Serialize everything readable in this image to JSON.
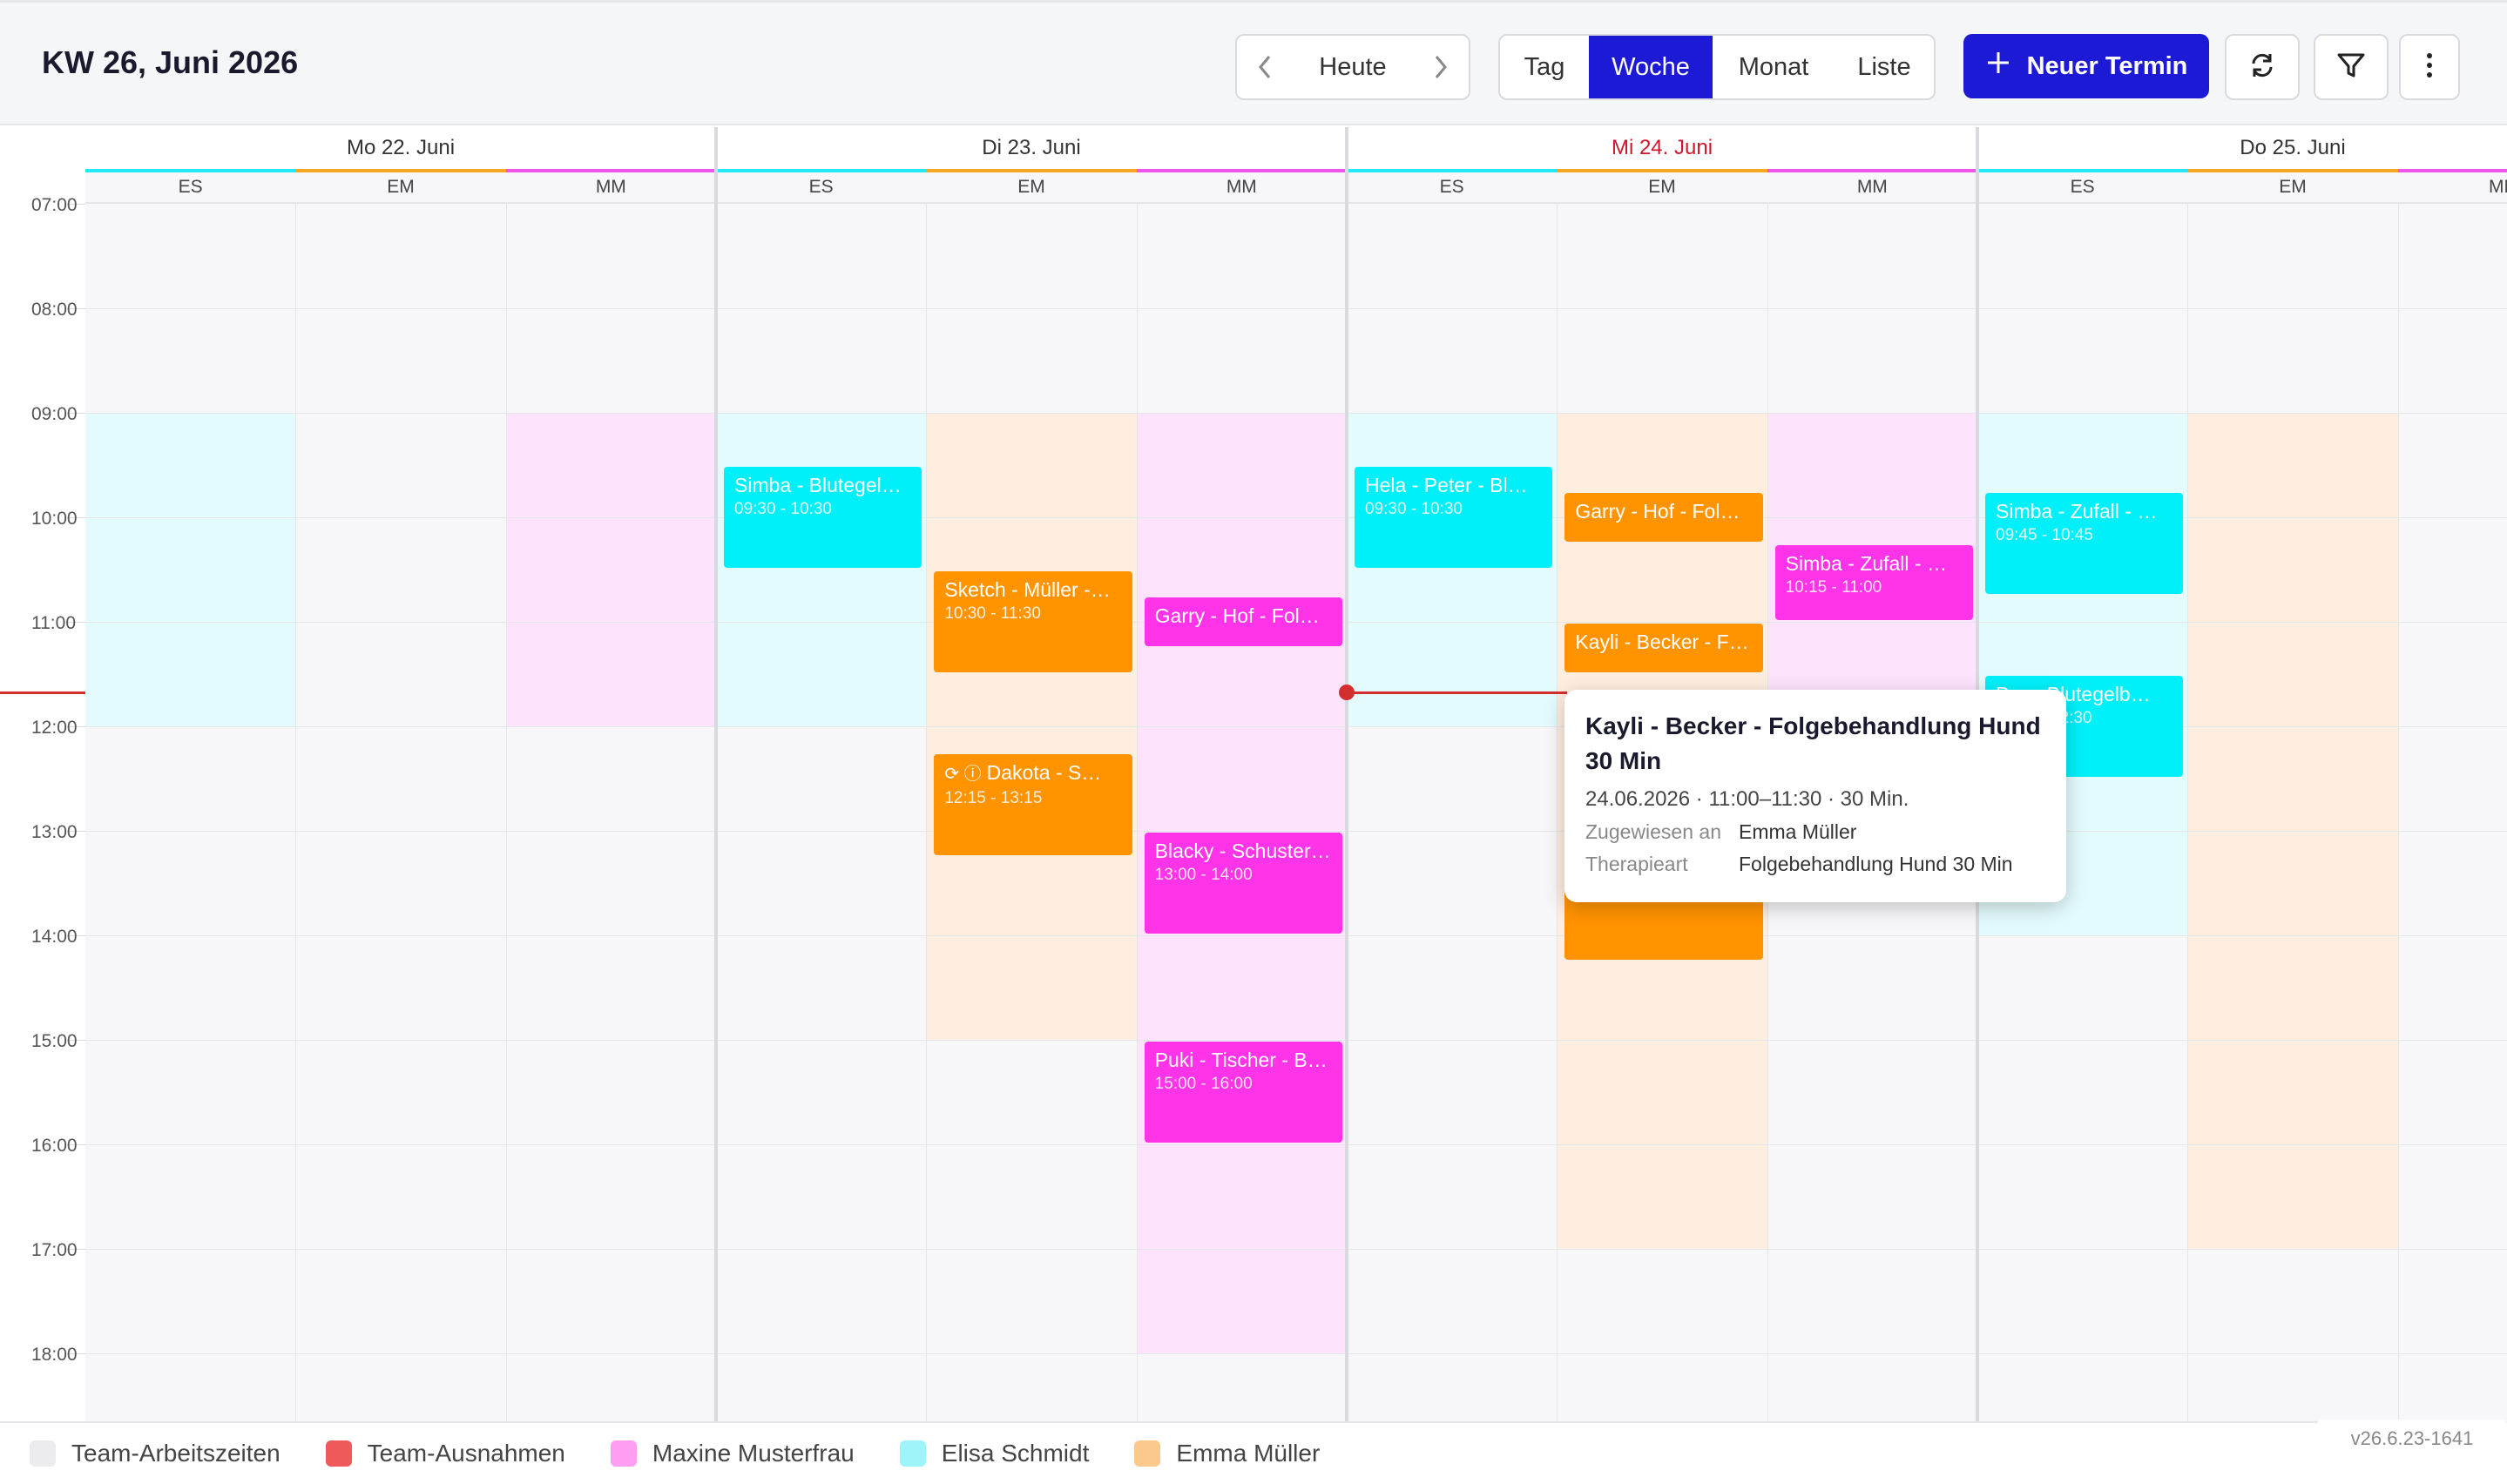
{
  "header": {
    "title": "KW 26, Juni 2026",
    "today_label": "Heute",
    "views": [
      "Tag",
      "Woche",
      "Monat",
      "Liste"
    ],
    "active_view": "Woche",
    "new_button_label": "Neuer Termin",
    "icons": [
      "chevron-left-icon",
      "chevron-right-icon",
      "plus-icon",
      "refresh-icon",
      "filter-icon",
      "more-vertical-icon"
    ]
  },
  "calendar": {
    "hours": [
      "07:00",
      "08:00",
      "09:00",
      "10:00",
      "11:00",
      "12:00",
      "13:00",
      "14:00",
      "15:00",
      "16:00",
      "17:00",
      "18:00"
    ],
    "days": [
      {
        "label": "Mo 22. Juni",
        "is_today": false,
        "resources": [
          "ES",
          "EM",
          "MM"
        ]
      },
      {
        "label": "Di 23. Juni",
        "is_today": false,
        "resources": [
          "ES",
          "EM",
          "MM"
        ]
      },
      {
        "label": "Mi 24. Juni",
        "is_today": true,
        "resources": [
          "ES",
          "EM",
          "MM"
        ]
      },
      {
        "label": "Do 25. Juni",
        "is_today": false,
        "resources": [
          "ES",
          "EM",
          "MN"
        ]
      }
    ],
    "resource_colors": {
      "ES": "#22e9f5",
      "EM": "#f5a623",
      "MM": "#ee55e8"
    },
    "now_time": "11:40",
    "events": [
      {
        "day": 1,
        "res": 0,
        "title": "Simba - Blutegel…",
        "time": "09:30 - 10:30",
        "start": 9.5,
        "end": 10.5,
        "color": "#00f0fa"
      },
      {
        "day": 1,
        "res": 1,
        "title": "Sketch - Müller -…",
        "time": "10:30 - 11:30",
        "start": 10.5,
        "end": 11.5,
        "color": "#ff9300"
      },
      {
        "day": 1,
        "res": 2,
        "title": "Garry - Hof - Fol…",
        "time": "",
        "start": 10.75,
        "end": 11.25,
        "color": "#ff33e8"
      },
      {
        "day": 1,
        "res": 1,
        "title": "Dakota - S…",
        "time": "12:15 - 13:15",
        "start": 12.25,
        "end": 13.25,
        "color": "#ff9300",
        "icons": true
      },
      {
        "day": 1,
        "res": 2,
        "title": "Blacky - Schuster…",
        "time": "13:00 - 14:00",
        "start": 13.0,
        "end": 14.0,
        "color": "#ff33e8"
      },
      {
        "day": 1,
        "res": 2,
        "title": "Puki - Tischer - B…",
        "time": "15:00 - 16:00",
        "start": 15.0,
        "end": 16.0,
        "color": "#ff33e8"
      },
      {
        "day": 2,
        "res": 0,
        "title": "Hela - Peter - Bl…",
        "time": "09:30 - 10:30",
        "start": 9.5,
        "end": 10.5,
        "color": "#00f0fa"
      },
      {
        "day": 2,
        "res": 1,
        "title": "Garry - Hof - Fol…",
        "time": "",
        "start": 9.75,
        "end": 10.25,
        "color": "#ff9300"
      },
      {
        "day": 2,
        "res": 2,
        "title": "Simba - Zufall - …",
        "time": "10:15 - 11:00",
        "start": 10.25,
        "end": 11.0,
        "color": "#ff33e8"
      },
      {
        "day": 2,
        "res": 1,
        "title": "Kayli - Becker - F…",
        "time": "",
        "start": 11.0,
        "end": 11.5,
        "color": "#ff9300"
      },
      {
        "day": 2,
        "res": 1,
        "title": "",
        "time": "13:15 - 14:15",
        "start": 13.25,
        "end": 14.25,
        "color": "#ff9300"
      },
      {
        "day": 3,
        "res": 0,
        "title": "Simba - Zufall - …",
        "time": "09:45 - 10:45",
        "start": 9.75,
        "end": 10.75,
        "color": "#00f0fa"
      },
      {
        "day": 3,
        "res": 0,
        "title": "P… - Blutegelb…",
        "time": "11:30 - 12:30",
        "start": 11.5,
        "end": 12.5,
        "color": "#00f0fa"
      }
    ],
    "availability": [
      {
        "day": 0,
        "res": 0,
        "start": 9.0,
        "end": 12.0,
        "color": "#e3fbfd"
      },
      {
        "day": 0,
        "res": 2,
        "start": 9.0,
        "end": 12.0,
        "color": "#fde3fb"
      },
      {
        "day": 1,
        "res": 0,
        "start": 9.0,
        "end": 12.0,
        "color": "#e3fbfd"
      },
      {
        "day": 1,
        "res": 1,
        "start": 9.0,
        "end": 15.0,
        "color": "#fdeee0"
      },
      {
        "day": 1,
        "res": 2,
        "start": 9.0,
        "end": 18.0,
        "color": "#fde3fb"
      },
      {
        "day": 2,
        "res": 0,
        "start": 9.0,
        "end": 12.0,
        "color": "#e3fbfd"
      },
      {
        "day": 2,
        "res": 1,
        "start": 9.0,
        "end": 17.0,
        "color": "#fdeee0"
      },
      {
        "day": 2,
        "res": 2,
        "start": 9.0,
        "end": 12.0,
        "color": "#fde3fb"
      },
      {
        "day": 3,
        "res": 0,
        "start": 9.0,
        "end": 14.0,
        "color": "#e3fbfd"
      },
      {
        "day": 3,
        "res": 1,
        "start": 9.0,
        "end": 17.0,
        "color": "#fdeee0"
      }
    ]
  },
  "tooltip": {
    "title": "Kayli - Becker - Folgebehandlung Hund 30 Min",
    "datetime": "24.06.2026 · 11:00–11:30 · 30 Min.",
    "rows": [
      {
        "key": "Zugewiesen an",
        "value": "Emma Müller"
      },
      {
        "key": "Therapieart",
        "value": "Folgebehandlung Hund 30 Min"
      }
    ]
  },
  "legend": [
    {
      "label": "Team-Arbeitszeiten",
      "color": "#ececee"
    },
    {
      "label": "Team-Ausnahmen",
      "color": "#ee5a5a"
    },
    {
      "label": "Maxine Musterfrau",
      "color": "#ff9ef2"
    },
    {
      "label": "Elisa Schmidt",
      "color": "#9ef4f9"
    },
    {
      "label": "Emma Müller",
      "color": "#fbc98c"
    }
  ],
  "version": "v26.6.23-1641"
}
